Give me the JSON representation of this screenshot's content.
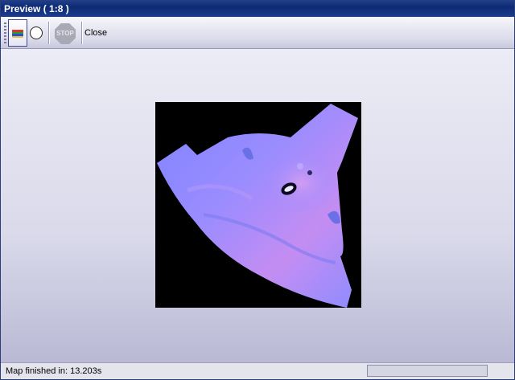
{
  "window": {
    "title": "Preview ( 1:8 )"
  },
  "toolbar": {
    "stop_label": "STOP",
    "close_label": "Close",
    "channel_colors": [
      "#d23a2a",
      "#2f9a3a",
      "#2b4fd0",
      "#e8c23a"
    ]
  },
  "status": {
    "message": "Map finished in: 13.203s",
    "progress": 0
  },
  "colors": {
    "accent": "#1a3d92",
    "map_bg": "#000000",
    "map_blue": "#8f8cff",
    "map_magenta": "#c88cf4"
  }
}
